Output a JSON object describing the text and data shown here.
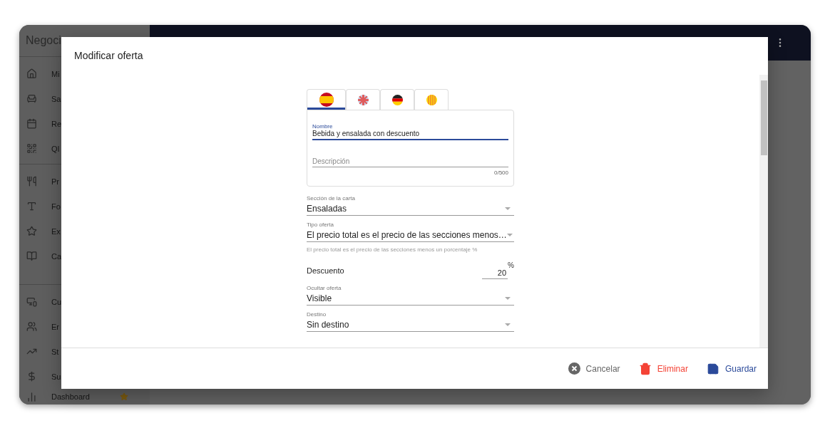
{
  "app": {
    "brand": "Negoci",
    "nav_groups": [
      [
        {
          "label": "Mi"
        },
        {
          "label": "Sa"
        },
        {
          "label": "Re"
        },
        {
          "label": "QI"
        }
      ],
      [
        {
          "label": "Pr"
        },
        {
          "label": "Fo"
        },
        {
          "label": "Ex"
        },
        {
          "label": "Ca"
        }
      ],
      [
        {
          "label": "Cu"
        },
        {
          "label": "Er"
        },
        {
          "label": "St"
        },
        {
          "label": "Su"
        },
        {
          "label": "Dashboard",
          "starred": true
        }
      ]
    ]
  },
  "dialog": {
    "title": "Modificar oferta",
    "language_tabs": [
      {
        "selected": true
      },
      {
        "selected": false
      },
      {
        "selected": false
      },
      {
        "selected": false
      }
    ],
    "name_field": {
      "label": "Nombre",
      "value": "Bebida y ensalada con descuento"
    },
    "description_field": {
      "placeholder": "Descripción",
      "counter": "0/500"
    },
    "fields": [
      {
        "kind": "select",
        "label": "Sección de la carta",
        "value": "Ensaladas"
      },
      {
        "kind": "select",
        "label": "Tipo oferta",
        "value": "El precio total es el precio de las secciones menos…",
        "helper": "El precio total es el precio de las secciones menos un porcentaje %"
      },
      {
        "kind": "number",
        "label": "Descuento",
        "value": "20",
        "unit": "%"
      },
      {
        "kind": "select",
        "label": "Ocultar oferta",
        "value": "Visible"
      },
      {
        "kind": "select",
        "label": "Destino",
        "value": "Sin destino"
      }
    ],
    "actions": [
      {
        "kind": "cancel",
        "label": "Cancelar"
      },
      {
        "kind": "delete",
        "label": "Eliminar"
      },
      {
        "kind": "save",
        "label": "Guardar"
      }
    ]
  }
}
